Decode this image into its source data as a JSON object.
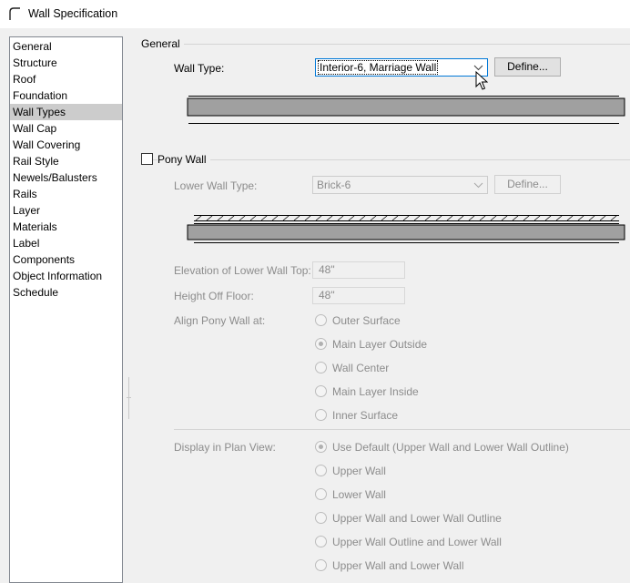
{
  "window": {
    "title": "Wall Specification"
  },
  "nav": {
    "selected_index": 4,
    "items": [
      "General",
      "Structure",
      "Roof",
      "Foundation",
      "Wall Types",
      "Wall Cap",
      "Wall Covering",
      "Rail Style",
      "Newels/Balusters",
      "Rails",
      "Layer",
      "Materials",
      "Label",
      "Components",
      "Object Information",
      "Schedule"
    ]
  },
  "general": {
    "title": "General",
    "wall_type_label": "Wall Type:",
    "wall_type_value": "Interior-6, Marriage Wall",
    "define_label": "Define..."
  },
  "pony": {
    "checkbox_label": "Pony Wall",
    "checked": false,
    "lower_wall_type_label": "Lower Wall Type:",
    "lower_wall_type_value": "Brick-6",
    "define_label": "Define...",
    "elevation_label": "Elevation of Lower Wall Top:",
    "elevation_value": "48\"",
    "height_label": "Height Off Floor:",
    "height_value": "48\"",
    "align_label": "Align Pony Wall at:",
    "align_options": [
      "Outer Surface",
      "Main Layer Outside",
      "Wall Center",
      "Main Layer Inside",
      "Inner Surface"
    ],
    "align_selected": 1,
    "display_label": "Display in Plan View:",
    "display_options": [
      "Use Default (Upper Wall and Lower Wall Outline)",
      "Upper Wall",
      "Lower Wall",
      "Upper Wall and Lower Wall Outline",
      "Upper Wall Outline and Lower Wall",
      "Upper Wall and Lower Wall"
    ],
    "display_selected": 0
  },
  "colors": {
    "wall_fill": "#a0a0a0",
    "focus_border": "#0078d7",
    "selected_nav": "#cccccc"
  }
}
